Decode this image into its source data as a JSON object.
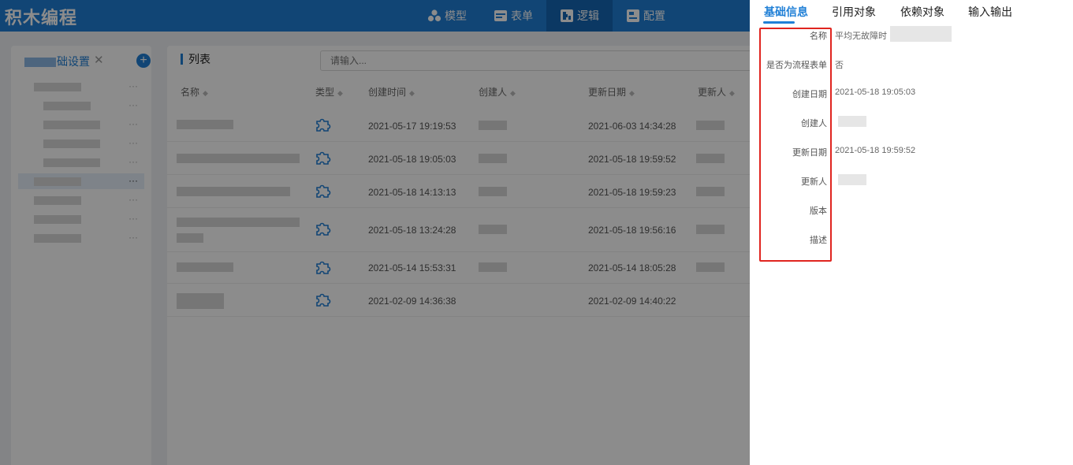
{
  "header": {
    "app_title": "积木编程",
    "nav": [
      {
        "label": "模型",
        "icon": "cubes-icon",
        "active": false
      },
      {
        "label": "表单",
        "icon": "form-icon",
        "active": false
      },
      {
        "label": "逻辑",
        "icon": "puzzle-logic-icon",
        "active": true
      },
      {
        "label": "配置",
        "icon": "config-icon",
        "active": false
      }
    ]
  },
  "left_panel": {
    "title_suffix": "础设置",
    "close_glyph": "✕",
    "add_glyph": "+",
    "item_more_glyph": "···"
  },
  "list_panel": {
    "title": "列表",
    "search_placeholder": "请输入...",
    "columns": [
      "名称",
      "类型",
      "创建时间",
      "创建人",
      "更新日期",
      "更新人"
    ],
    "rows": [
      {
        "created": "2021-05-17 19:19:53",
        "updated": "2021-06-03 14:34:28"
      },
      {
        "created": "2021-05-18 19:05:03",
        "updated": "2021-05-18 19:59:52"
      },
      {
        "created": "2021-05-18 14:13:13",
        "updated": "2021-05-18 19:59:23"
      },
      {
        "created": "2021-05-18 13:24:28",
        "updated": "2021-05-18 19:56:16"
      },
      {
        "created": "2021-05-14 15:53:31",
        "updated": "2021-05-14 18:05:28"
      },
      {
        "created": "2021-02-09 14:36:38",
        "updated": "2021-02-09 14:40:22"
      }
    ]
  },
  "drawer": {
    "tabs": [
      "基础信息",
      "引用对象",
      "依赖对象",
      "输入输出"
    ],
    "active_tab": 0,
    "fields": [
      {
        "label": "名称",
        "value": "平均无故障时"
      },
      {
        "label": "是否为流程表单",
        "value": "否"
      },
      {
        "label": "创建日期",
        "value": "2021-05-18 19:05:03"
      },
      {
        "label": "创建人",
        "value": ""
      },
      {
        "label": "更新日期",
        "value": "2021-05-18 19:59:52"
      },
      {
        "label": "更新人",
        "value": ""
      },
      {
        "label": "版本",
        "value": ""
      },
      {
        "label": "描述",
        "value": ""
      }
    ]
  },
  "colors": {
    "primary": "#1f7fd6",
    "header_bg": "#1f7fd6",
    "nav_active_bg": "#1566b5",
    "highlight_box": "#e0251f"
  }
}
